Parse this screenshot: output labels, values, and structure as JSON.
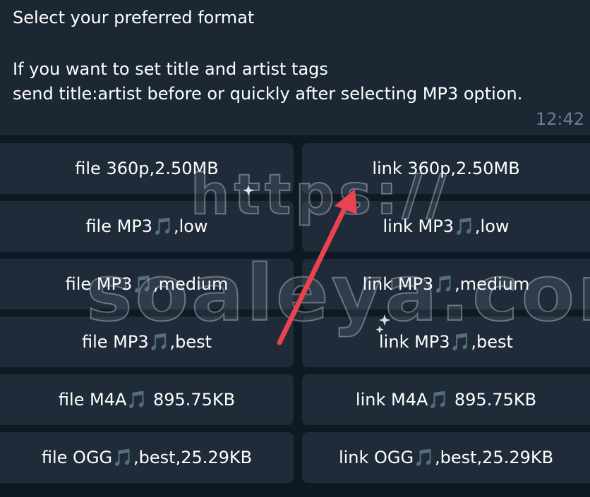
{
  "message": {
    "line1": "Select your preferred format",
    "line2": "If you want to set title and artist tags",
    "line3": "send title:artist before or quickly after selecting MP3 option.",
    "time": "12:42"
  },
  "buttons": [
    {
      "left": "file 360p,2.50MB",
      "right": "link 360p,2.50MB"
    },
    {
      "left": "file MP3🎵,low",
      "right": "link MP3🎵,low"
    },
    {
      "left": "file MP3🎵,medium",
      "right": "link MP3🎵,medium"
    },
    {
      "left": "file MP3🎵,best",
      "right": "link MP3🎵,best"
    },
    {
      "left": "file M4A🎵 895.75KB",
      "right": "link M4A🎵 895.75KB"
    },
    {
      "left": "file OGG🎵,best,25.29KB",
      "right": "link OGG🎵,best,25.29KB"
    }
  ],
  "watermark": {
    "line1": "https://",
    "line2": "soaleya.com"
  },
  "colors": {
    "background": "#0f1923",
    "bubble": "#1c2734",
    "button": "#1f2b39",
    "arrow": "#e8434f",
    "time": "#6e7d8e"
  }
}
